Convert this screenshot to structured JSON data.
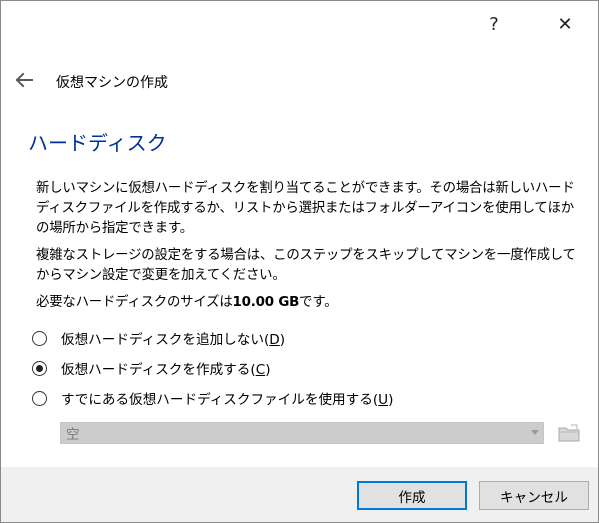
{
  "titlebar": {
    "help_label": "?",
    "close_label": "✕"
  },
  "wizard": {
    "title": "仮想マシンの作成"
  },
  "page": {
    "heading": "ハードディスク",
    "para1": "新しいマシンに仮想ハードディスクを割り当てることができます。その場合は新しいハードディスクファイルを作成するか、リストから選択またはフォルダーアイコンを使用してほかの場所から指定できます。",
    "para2": "複雑なストレージの設定をする場合は、このステップをスキップしてマシンを一度作成してからマシン設定で変更を加えてください。",
    "para3_prefix": "必要なハードディスクのサイズは",
    "para3_size": "10.00 GB",
    "para3_suffix": "です。"
  },
  "options": [
    {
      "label": "仮想ハードディスクを追加しない",
      "mnemonic": "D",
      "checked": false
    },
    {
      "label": "仮想ハードディスクを作成する",
      "mnemonic": "C",
      "checked": true
    },
    {
      "label": "すでにある仮想ハードディスクファイルを使用する",
      "mnemonic": "U",
      "checked": false
    }
  ],
  "existing_disk": {
    "value": "空"
  },
  "buttons": {
    "create": "作成",
    "cancel": "キャンセル"
  },
  "colors": {
    "heading": "#003399",
    "primary_border": "#0078d7",
    "footer_bg": "#f0f0f0"
  },
  "icons": {
    "back": "arrow-left-icon",
    "folder": "folder-icon",
    "close": "close-icon",
    "help": "help-icon"
  }
}
